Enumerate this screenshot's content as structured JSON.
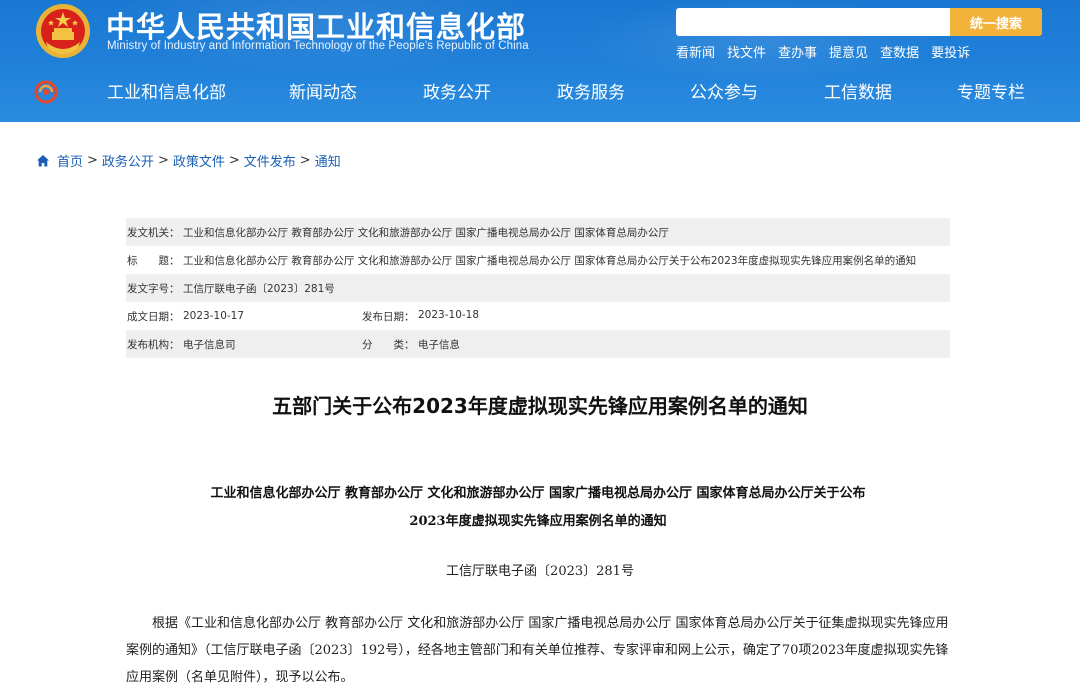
{
  "header": {
    "title": "中华人民共和国工业和信息化部",
    "subtitle": "Ministry of Industry and Information Technology of the People's Republic of China",
    "search_placeholder": "",
    "search_button": "统一搜索",
    "quick_links": [
      "看新闻",
      "找文件",
      "查办事",
      "提意见",
      "查数据",
      "要投诉"
    ]
  },
  "nav": {
    "items": [
      "工业和信息化部",
      "新闻动态",
      "政务公开",
      "政务服务",
      "公众参与",
      "工信数据",
      "专题专栏"
    ]
  },
  "breadcrumb": {
    "items": [
      "首页",
      "政务公开",
      "政策文件",
      "文件发布",
      "通知"
    ],
    "separator": ">"
  },
  "meta": {
    "issuer_label": "发文机关：",
    "issuer": "工业和信息化部办公厅 教育部办公厅 文化和旅游部办公厅 国家广播电视总局办公厅 国家体育总局办公厅",
    "title_label": "标　　题：",
    "title": "工业和信息化部办公厅 教育部办公厅 文化和旅游部办公厅 国家广播电视总局办公厅 国家体育总局办公厅关于公布2023年度虚拟现实先锋应用案例名单的通知",
    "doc_no_label": "发文字号：",
    "doc_no": "工信厅联电子函〔2023〕281号",
    "created_label": "成文日期：",
    "created": "2023-10-17",
    "published_label": "发布日期：",
    "published": "2023-10-18",
    "org_label": "发布机构：",
    "org": "电子信息司",
    "category_label": "分　　类：",
    "category": "电子信息"
  },
  "article": {
    "title": "五部门关于公布2023年度虚拟现实先锋应用案例名单的通知",
    "heading_line1": "工业和信息化部办公厅 教育部办公厅 文化和旅游部办公厅 国家广播电视总局办公厅 国家体育总局办公厅关于公布",
    "heading_line2": "2023年度虚拟现实先锋应用案例名单的通知",
    "doc_number": "工信厅联电子函〔2023〕281号",
    "body": "根据《工业和信息化部办公厅 教育部办公厅 文化和旅游部办公厅 国家广播电视总局办公厅 国家体育总局办公厅关于征集虚拟现实先锋应用案例的通知》（工信厅联电子函〔2023〕192号），经各地主管部门和有关单位推荐、专家评审和网上公示，确定了70项2023年度虚拟现实先锋应用案例（名单见附件），现予以公布。"
  },
  "colors": {
    "header_blue": "#1f7fd8",
    "search_button": "#f3b23a",
    "link_blue": "#1a5fb4",
    "meta_shade": "#efefef"
  }
}
